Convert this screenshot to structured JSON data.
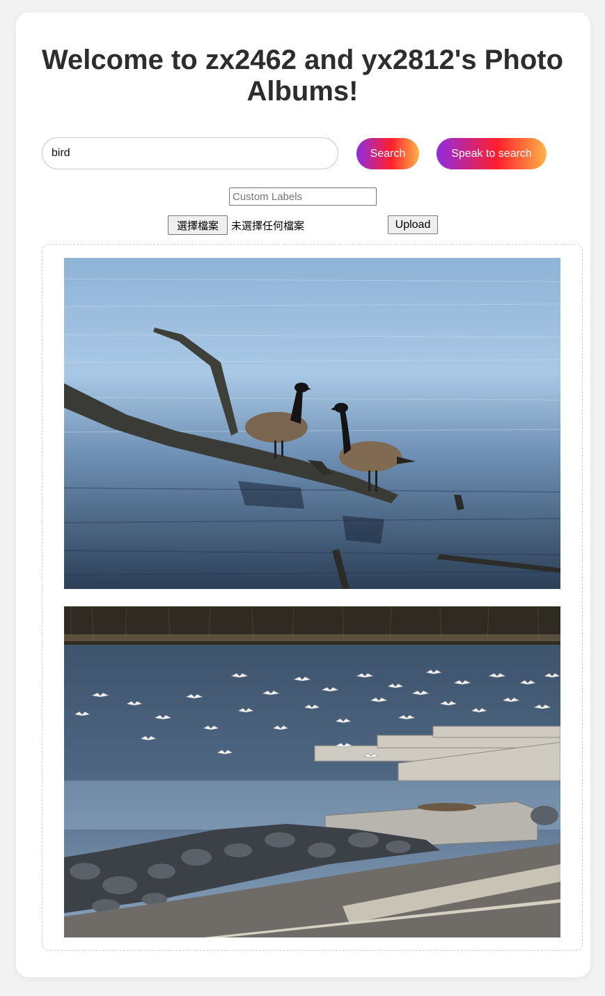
{
  "header": {
    "title": "Welcome to zx2462 and yx2812's Photo Albums!"
  },
  "search": {
    "value": "bird",
    "search_label": "Search",
    "speak_label": "Speak to search"
  },
  "upload": {
    "labels_placeholder": "Custom Labels",
    "choose_file_label": "選擇檔案",
    "file_status": "未選擇任何檔案",
    "upload_label": "Upload"
  },
  "results": {
    "photos": [
      {
        "subject": "two Canada geese on a fallen branch in a lake"
      },
      {
        "subject": "flock of gulls over a lake by a floating dock and rocky shore"
      }
    ]
  },
  "colors": {
    "gradient": [
      "#8e2de2",
      "#ff1e2d",
      "#ffb347"
    ],
    "title_text": "#2d2d2d",
    "page_bg": "#f2f2f2"
  }
}
